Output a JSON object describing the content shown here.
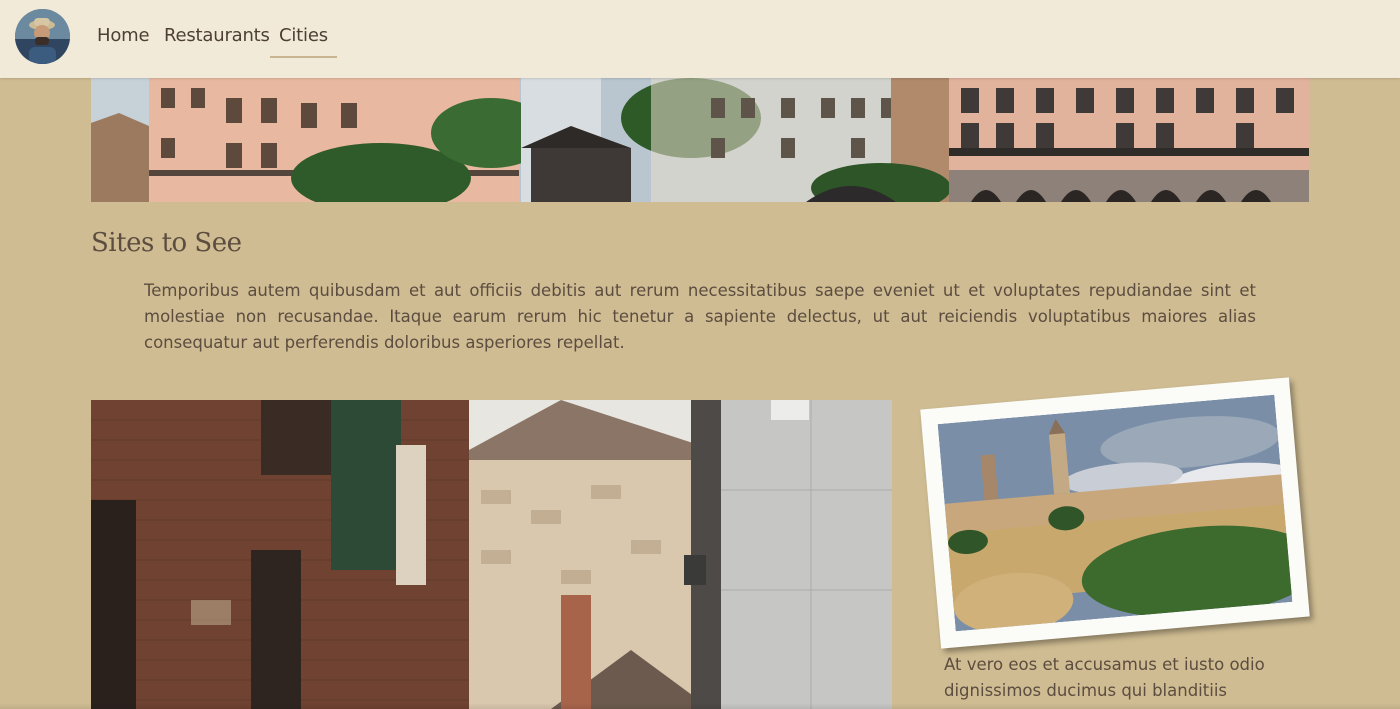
{
  "nav": {
    "avatar_icon": "profile-avatar",
    "links": [
      {
        "label": "Home",
        "active": false
      },
      {
        "label": "Restaurants",
        "active": false
      },
      {
        "label": "Cities",
        "active": true
      }
    ],
    "active_underline_color": "#c9b592"
  },
  "banner": {
    "icon": "plaza-photo"
  },
  "section": {
    "title": "Sites to See",
    "intro": "Temporibus autem quibusdam et aut officiis debitis aut rerum necessitatibus saepe eveniet ut et voluptates repudiandae sint et molestiae non recusandae. Itaque earum rerum hic tenetur a sapiente delectus, ut aut reiciendis voluptatibus maiores alias consequatur aut perferendis doloribus asperiores repellat."
  },
  "photos": {
    "street_icon": "street-photo",
    "polaroid_icon": "city-wall-photo",
    "caption": "At vero eos et accusamus et iusto odio dignissimos ducimus qui blanditiis"
  },
  "colors": {
    "page_background": "#cfbc92",
    "nav_background": "#f2ead9",
    "text": "#5c4d40"
  }
}
